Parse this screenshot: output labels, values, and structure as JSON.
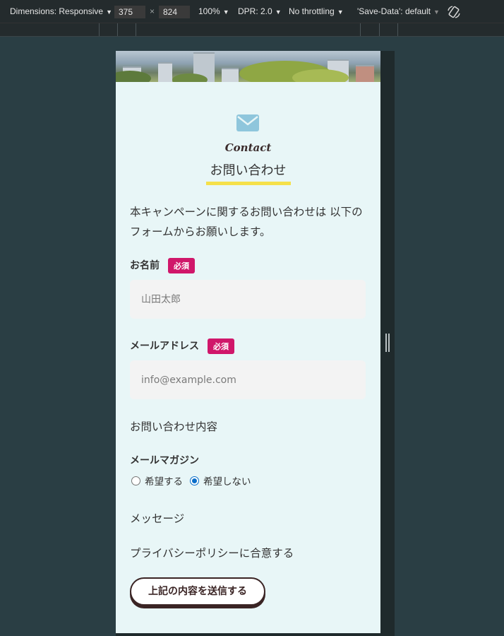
{
  "devtools": {
    "dimensions_label": "Dimensions: Responsive",
    "width_value": "375",
    "times": "×",
    "height_value": "824",
    "zoom": "100%",
    "dpr": "DPR: 2.0",
    "throttling": "No throttling",
    "save_data": "'Save-Data': default",
    "rotate_icon": "rotate-icon"
  },
  "page": {
    "mail_icon": "mail-icon",
    "heading_en": "Contact",
    "heading_jp": "お問い合わせ",
    "accent_color": "#f5e04a",
    "intro": "本キャンペーンに関するお問い合わせは 以下のフォームからお願いします。",
    "form": {
      "name": {
        "label": "お名前",
        "required_badge": "必須",
        "placeholder": "山田太郎"
      },
      "email": {
        "label": "メールアドレス",
        "required_badge": "必須",
        "placeholder": "info@example.com"
      },
      "inquiry_label": "お問い合わせ内容",
      "newsletter": {
        "label": "メールマガジン",
        "options": [
          {
            "label": "希望する",
            "checked": false
          },
          {
            "label": "希望しない",
            "checked": true
          }
        ]
      },
      "message_label": "メッセージ",
      "privacy_label": "プライバシーポリシーに合意する",
      "submit_label": "上記の内容を送信する"
    },
    "badge_color": "#d0176a"
  }
}
